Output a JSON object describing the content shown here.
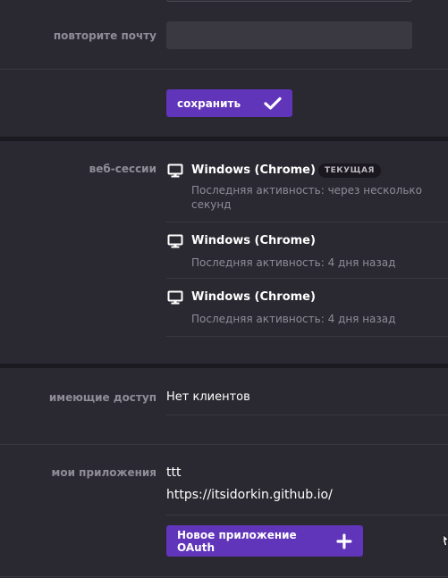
{
  "email": {
    "repeat_label": "повторите почту",
    "repeat_value": ""
  },
  "save_button": {
    "label": "сохранить",
    "icon": "check-icon"
  },
  "web_sessions": {
    "label": "веб-сессии",
    "items": [
      {
        "title": "Windows (Chrome)",
        "badge": "ТЕКУЩАЯ",
        "activity": "Последняя активность: через несколько секунд",
        "icon": "monitor-icon"
      },
      {
        "title": "Windows (Chrome)",
        "activity": "Последняя активность: 4 дня назад",
        "icon": "monitor-icon"
      },
      {
        "title": "Windows (Chrome)",
        "activity": "Последняя активность: 4 дня назад",
        "icon": "monitor-icon"
      }
    ]
  },
  "access": {
    "label": "имеющие доступ",
    "value": "Нет клиентов"
  },
  "apps": {
    "label": "мои приложения",
    "items": [
      {
        "name": "ttt",
        "url": "https://itsidorkin.github.io/"
      }
    ],
    "new_button": {
      "label": "Новое приложение OAuth",
      "icon": "plus-icon"
    }
  },
  "colors": {
    "accent": "#6035b9",
    "background": "#2a2830",
    "separator": "#1b1a20"
  }
}
